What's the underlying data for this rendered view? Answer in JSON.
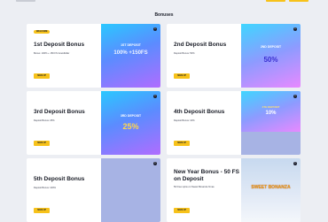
{
  "page": {
    "title": "Bonuses"
  },
  "cards": [
    {
      "tag": "WELCOME",
      "title": "1st Deposit Bonus",
      "subtitle": "Bonus: 100% + 150 FS Grandfeller",
      "button": "SIGN UP",
      "promo_small": "1ST DEPOSIT",
      "promo_big": "100% +150FS"
    },
    {
      "title": "2nd Deposit Bonus",
      "subtitle": "Deposit Bonus: 50%",
      "button": "SIGN UP",
      "promo_small": "2ND DEPOSIT",
      "promo_big": "50%"
    },
    {
      "title": "3rd Deposit Bonus",
      "subtitle": "Deposit Bonus: 25%",
      "button": "SIGN UP",
      "promo_small": "3RD DEPOSIT",
      "promo_big": "25%"
    },
    {
      "title": "4th Deposit Bonus",
      "subtitle": "Deposit Bonus: 10%",
      "button": "SIGN UP",
      "promo_small": "4TH DEPOSIT",
      "promo_big": "10%"
    },
    {
      "title": "5th Deposit Bonus",
      "subtitle": "Deposit Bonus: 100%",
      "button": "SIGN UP"
    },
    {
      "title": "New Year Bonus - 50 FS on Deposit",
      "subtitle": "50 Free spins on Sweet Bonanza Xmas",
      "button": "SIGN UP",
      "promo_small": "SWEET BONANZA"
    }
  ],
  "info_icon": "i",
  "colors": {
    "accent": "#f7c21a",
    "background": "#eceef3",
    "card": "#ffffff"
  }
}
